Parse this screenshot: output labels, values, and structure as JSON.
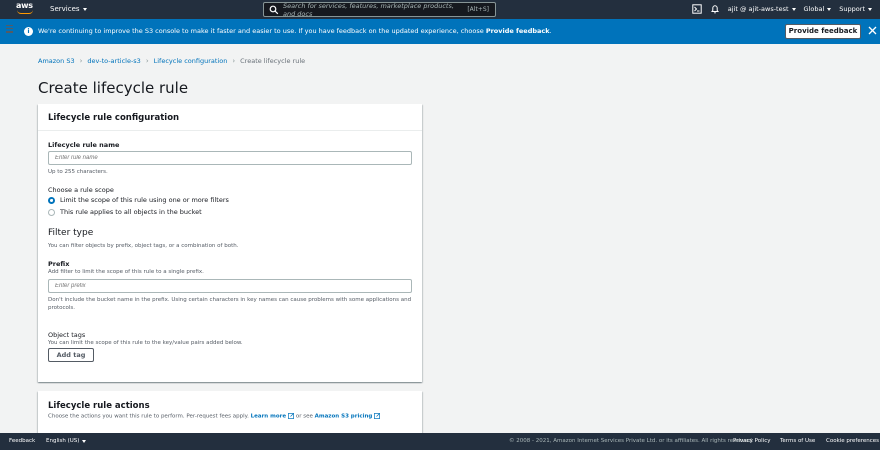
{
  "topnav": {
    "logo_text": "aws",
    "services_label": "Services",
    "search_placeholder": "Search for services, features, marketplace products, and docs",
    "search_shortcut": "[Alt+S]",
    "account_label": "ajit @ ajit-aws-test",
    "region_label": "Global",
    "support_label": "Support"
  },
  "banner": {
    "message": "We're continuing to improve the S3 console to make it faster and easier to use. If you have feedback on the updated experience, choose ",
    "message_bold": "Provide feedback",
    "message_end": ".",
    "button_label": "Provide feedback",
    "icon_glyph": "i"
  },
  "breadcrumb": {
    "items": [
      "Amazon S3",
      "dev-to-article-s3",
      "Lifecycle configuration"
    ],
    "current": "Create lifecycle rule",
    "separator": "›"
  },
  "page_title": "Create lifecycle rule",
  "config_panel": {
    "title": "Lifecycle rule configuration",
    "rule_name_label": "Lifecycle rule name",
    "rule_name_placeholder": "Enter rule name",
    "rule_name_value": "",
    "rule_name_hint": "Up to 255 characters.",
    "scope_label": "Choose a rule scope",
    "scope_options": [
      {
        "label": "Limit the scope of this rule using one or more filters",
        "selected": true
      },
      {
        "label": "This rule applies to all objects in the bucket",
        "selected": false
      }
    ],
    "filter_title": "Filter type",
    "filter_desc": "You can filter objects by prefix, object tags, or a combination of both.",
    "prefix_label": "Prefix",
    "prefix_desc": "Add filter to limit the scope of this rule to a single prefix.",
    "prefix_placeholder": "Enter prefix",
    "prefix_value": "",
    "prefix_hint": "Don't include the bucket name in the prefix. Using certain characters in key names can cause problems with some applications and protocols.",
    "tags_label": "Object tags",
    "tags_desc": "You can limit the scope of this rule to the key/value pairs added below.",
    "add_tag_label": "Add tag"
  },
  "actions_panel": {
    "title": "Lifecycle rule actions",
    "desc_start": "Choose the actions you want this rule to perform. Per-request fees apply. ",
    "learn_more": "Learn more",
    "desc_mid": " or see ",
    "pricing_link": "Amazon S3 pricing"
  },
  "footer": {
    "feedback": "Feedback",
    "language": "English (US)",
    "copyright": "© 2008 - 2021, Amazon Internet Services Private Ltd. or its affiliates. All rights reserved.",
    "privacy": "Privacy Policy",
    "terms": "Terms of Use",
    "cookies": "Cookie preferences"
  },
  "colors": {
    "nav_bg": "#232f3e",
    "banner_bg": "#0073bb",
    "link": "#0073bb",
    "accent": "#ff9900",
    "page_bg": "#f2f3f3"
  },
  "icons": [
    "menu-icon",
    "search-icon",
    "cloudshell-icon",
    "bell-icon",
    "info-icon",
    "close-icon",
    "external-link-icon"
  ]
}
